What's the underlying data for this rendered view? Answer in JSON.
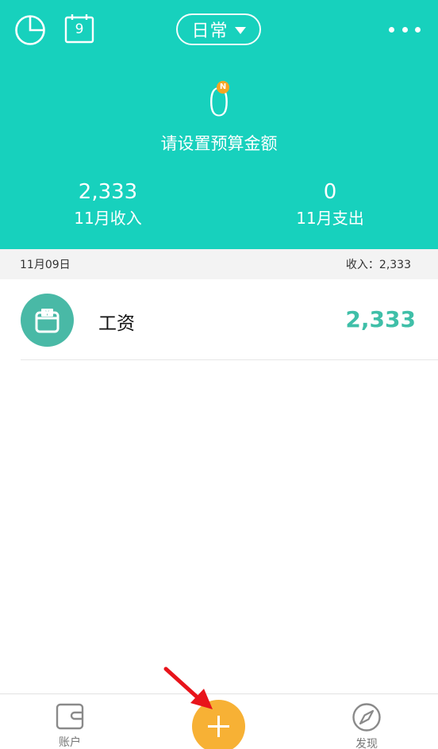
{
  "header": {
    "calendar_day": "9",
    "book_selector": "日常",
    "budget_value": "0",
    "budget_badge": "N",
    "budget_hint": "请设置预算金额",
    "income": {
      "value": "2,333",
      "label": "11月收入"
    },
    "expense": {
      "value": "0",
      "label": "11月支出"
    }
  },
  "date_group": {
    "date": "11月09日",
    "summary": "收入：2,333"
  },
  "transactions": [
    {
      "category": "工资",
      "amount": "2,333",
      "icon": "wallet-icon"
    }
  ],
  "bottom_nav": {
    "accounts_label": "账户",
    "discover_label": "发现",
    "add_icon": "plus-icon"
  },
  "colors": {
    "header": "#17d1bd",
    "income_amount": "#3fbfa8",
    "category_avatar": "#49b9a6",
    "add_button": "#f7b135",
    "badge": "#f5a623",
    "annotation_arrow": "#e8141b"
  }
}
